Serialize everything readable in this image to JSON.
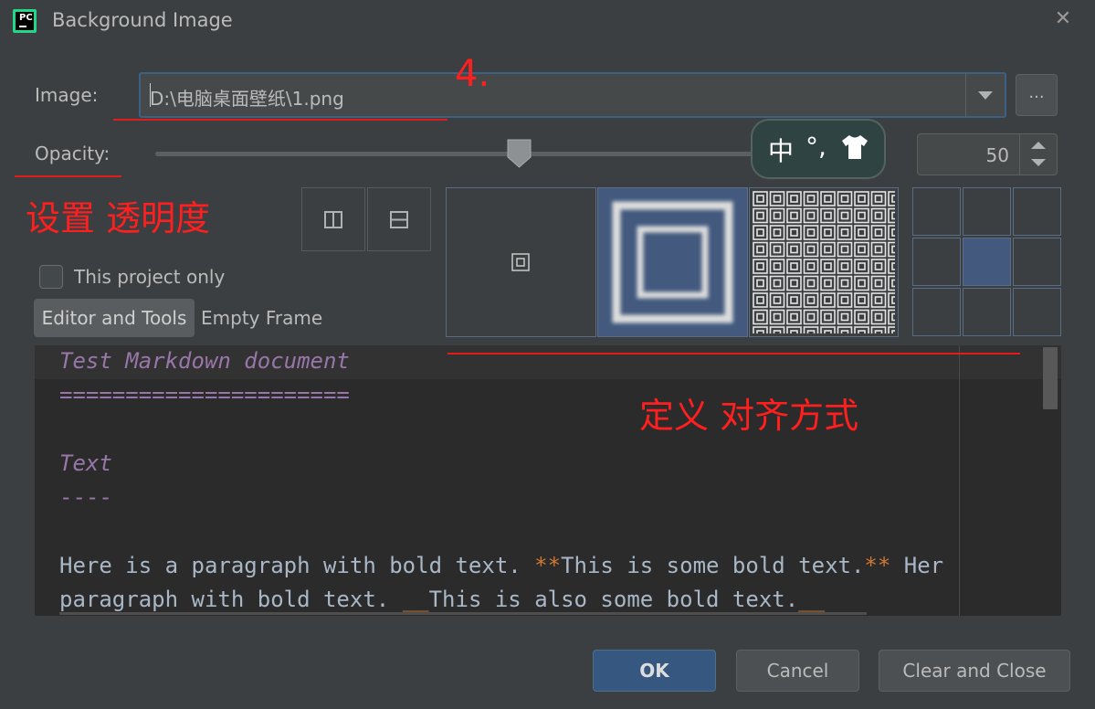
{
  "window": {
    "title": "Background Image",
    "close_glyph": "✕"
  },
  "image_field": {
    "label": "Image:",
    "value": "D:\\电脑桌面壁纸\\1.png",
    "browse_label": "..."
  },
  "opacity": {
    "label": "Opacity:",
    "value": "50",
    "slider_fraction": 0.5
  },
  "ime_bar": {
    "char": "中",
    "punct": "°,",
    "skin_icon": "shirt-icon"
  },
  "annotations": {
    "step": "4.",
    "opacity_note": "设置 透明度",
    "alignment_note": "定义 对齐方式"
  },
  "options": {
    "project_only_label": "This project only",
    "project_only_checked": false
  },
  "tabs": [
    {
      "label": "Editor and Tools",
      "selected": true
    },
    {
      "label": "Empty Frame",
      "selected": false
    }
  ],
  "preview": {
    "lines": [
      {
        "kind": "heading",
        "text": "Test Markdown document"
      },
      {
        "kind": "heading",
        "text": "======================"
      },
      {
        "kind": "empty",
        "text": ""
      },
      {
        "kind": "heading",
        "text": "Text"
      },
      {
        "kind": "heading",
        "text": "----"
      },
      {
        "kind": "empty",
        "text": ""
      }
    ],
    "para1": {
      "text1": "Here is a paragraph with bold text. ",
      "mark1": "**",
      "bold": "This is some bold text.",
      "mark2": "**",
      "text2": " Her"
    },
    "para2": {
      "text1": "paragraph with bold text. ",
      "mark1": "__",
      "bold": "This is also some bold text.",
      "mark2": "__"
    }
  },
  "buttons": {
    "ok": "OK",
    "cancel": "Cancel",
    "clear_close": "Clear and Close"
  },
  "colors": {
    "accent": "#365880",
    "fill_selected": "#435a7e",
    "annotation": "#ff1f1f",
    "heading": "#9876aa",
    "markup": "#cc7832"
  }
}
